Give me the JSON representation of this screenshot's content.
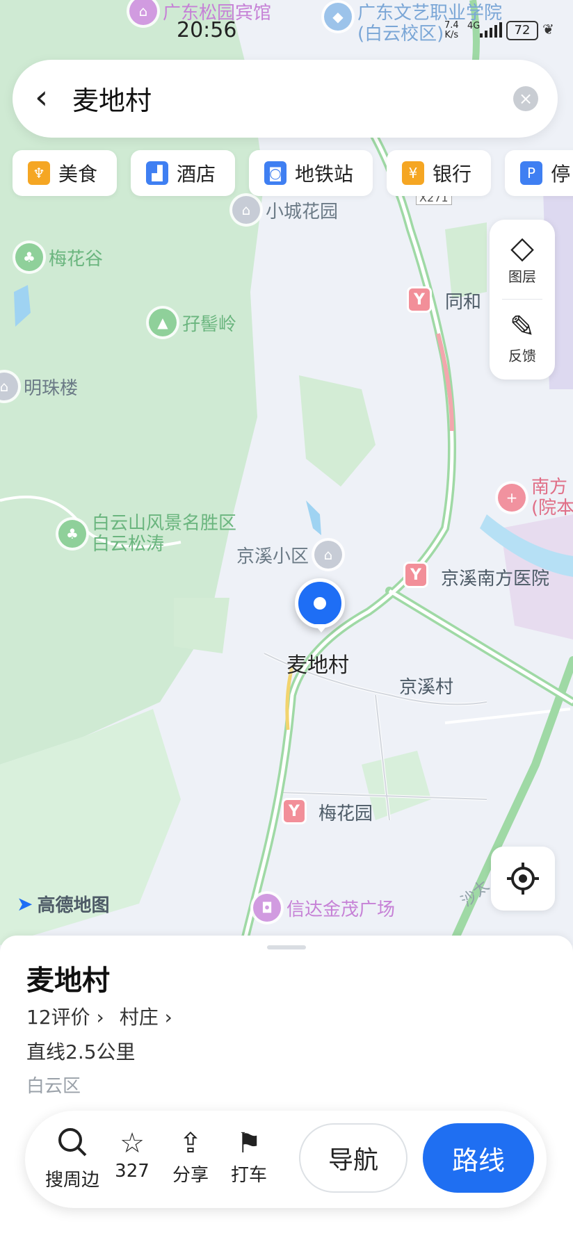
{
  "status_bar": {
    "time": "20:56",
    "net_speed": "7.4",
    "net_speed_unit": "K/s",
    "network": "4G",
    "battery": "72"
  },
  "search": {
    "query": "麦地村"
  },
  "chips": [
    {
      "label": "美食",
      "icon": "fork-knife-icon",
      "color": "#f5a623"
    },
    {
      "label": "酒店",
      "icon": "hotel-icon",
      "color": "#3f7ff2"
    },
    {
      "label": "地铁站",
      "icon": "subway-icon",
      "color": "#3f7ff2"
    },
    {
      "label": "银行",
      "icon": "bank-icon",
      "color": "#f5a623"
    },
    {
      "label": "停",
      "icon": "parking-icon",
      "color": "#3f7ff2"
    }
  ],
  "map_controls": {
    "layers_label": "图层",
    "feedback_label": "反馈"
  },
  "map": {
    "brand": "高德地图",
    "pois": [
      {
        "name": "广东松园宾馆",
        "style": "purple"
      },
      {
        "name": "广东文艺职业学院",
        "style": "blue"
      },
      {
        "name": "(白云校区)",
        "style": "blue"
      },
      {
        "name": "小城花园",
        "style": "gray"
      },
      {
        "name": "梅花谷",
        "style": "green"
      },
      {
        "name": "孖髻岭",
        "style": "green"
      },
      {
        "name": "明珠楼",
        "style": "gray"
      },
      {
        "name": "白云山风景名胜区",
        "style": "green"
      },
      {
        "name": "白云松涛",
        "style": "green"
      },
      {
        "name": "京溪小区",
        "style": "gray"
      },
      {
        "name": "南方",
        "style": "pink"
      },
      {
        "name": "(院本",
        "style": "pink"
      },
      {
        "name": "信达金茂广场",
        "style": "purple"
      }
    ],
    "metro_stations": [
      "同和",
      "京溪南方医院",
      "梅花园"
    ],
    "labels": [
      "京溪村",
      "X271",
      "沙太"
    ],
    "marker_label": "麦地村"
  },
  "place": {
    "title": "麦地村",
    "reviews": "12评价",
    "category": "村庄",
    "distance": "直线2.5公里",
    "district": "白云区"
  },
  "actions": {
    "nearby": "搜周边",
    "favorites": "327",
    "share": "分享",
    "taxi": "打车",
    "navigate": "导航",
    "route": "路线"
  }
}
